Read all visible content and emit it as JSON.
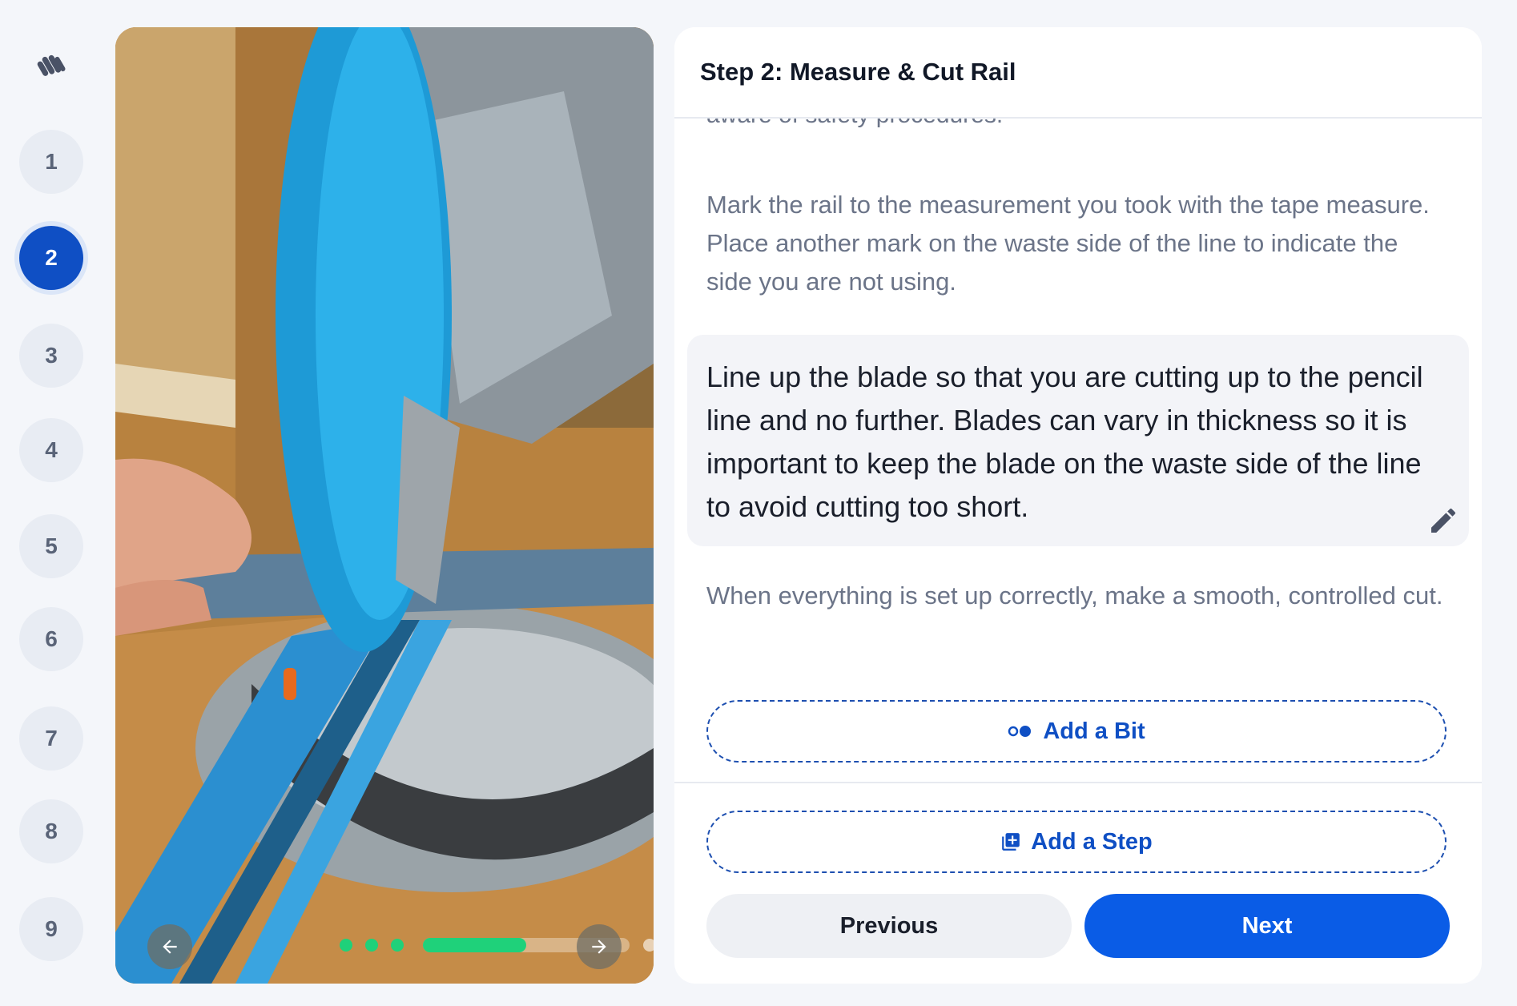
{
  "sidebar": {
    "logo_icon": "dozuki-hand-logo-icon",
    "steps": [
      "1",
      "2",
      "3",
      "4",
      "5",
      "6",
      "7",
      "8",
      "9"
    ],
    "active_step": "2"
  },
  "media": {
    "image_icon": "miter-saw-photo",
    "prev_icon": "arrow-left-icon",
    "next_icon": "arrow-right-icon",
    "progress": 0.5
  },
  "panel": {
    "title": "Step 2: Measure & Cut Rail",
    "clipped_text": "aware of safety procedures.",
    "para1": "Mark the rail to the measurement you took with the tape measure. Place another mark on the waste side of the line to indicate the side you are not using.",
    "highlight": "Line up the blade so that you are cutting up to the pencil line and no further. Blades can vary in thickness so it is important to keep the blade on the waste side of the line to avoid cutting too short.",
    "para2": "When everything is set up correctly, make a smooth, controlled cut.",
    "add_bit": "Add a Bit",
    "add_step": "Add a Step",
    "previous": "Previous",
    "next": "Next"
  },
  "colors": {
    "accent": "#0a5ce6",
    "active_step": "#0f4fc4",
    "progress": "#1fd17a"
  }
}
